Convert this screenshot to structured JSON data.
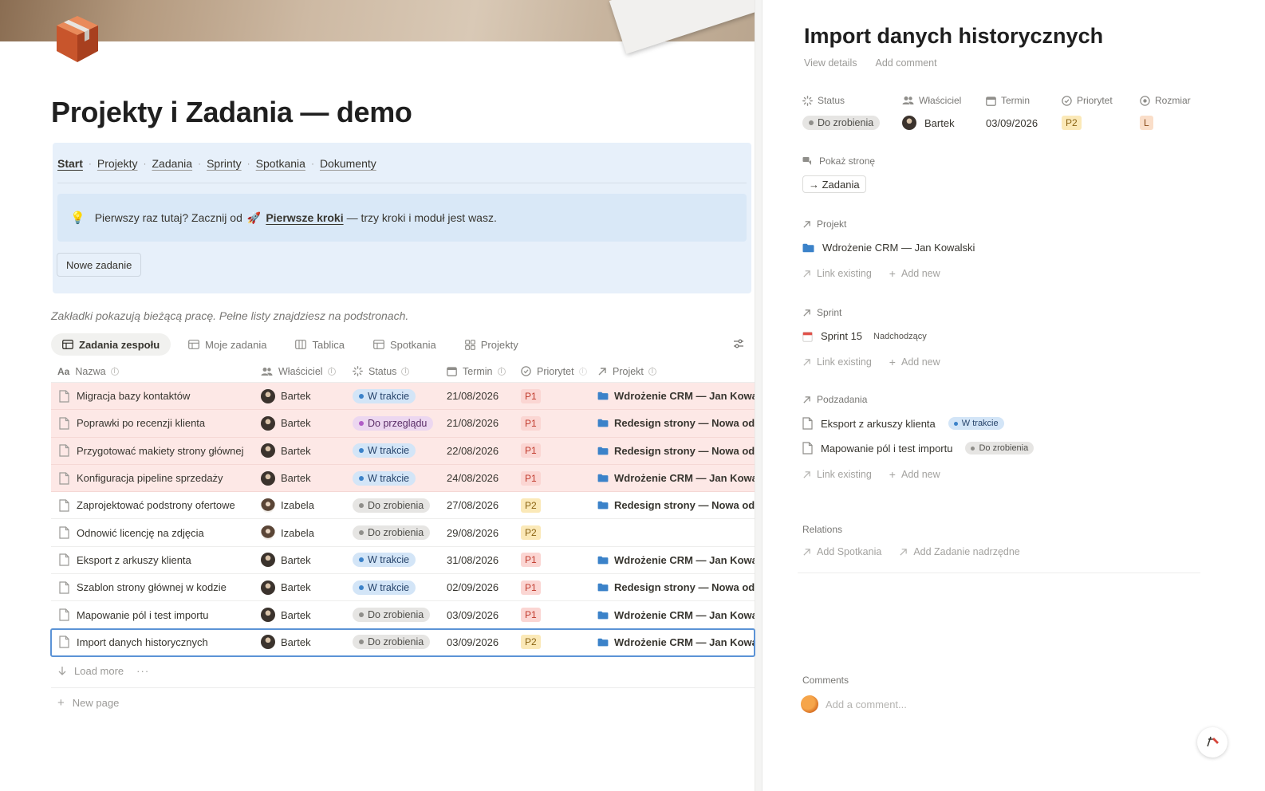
{
  "left": {
    "page_title": "Projekty i Zadania — demo",
    "nav": {
      "items": [
        "Start",
        "Projekty",
        "Zadania",
        "Sprinty",
        "Spotkania",
        "Dokumenty"
      ],
      "separator": "·"
    },
    "tip": {
      "lead": "Pierwszy raz tutaj? Zacznij od",
      "link": "Pierwsze kroki",
      "tail": "— trzy kroki i moduł jest wasz."
    },
    "new_task_button": "Nowe zadanie",
    "note": "Zakładki pokazują bieżącą pracę. Pełne listy znajdziesz na podstronach.",
    "tabs": [
      "Zadania zespołu",
      "Moje zadania",
      "Tablica",
      "Spotkania",
      "Projekty"
    ],
    "columns": [
      "Nazwa",
      "Właściciel",
      "Status",
      "Termin",
      "Priorytet",
      "Projekt"
    ],
    "rows": [
      {
        "name": "Migracja bazy kontaktów",
        "owner": "Bartek",
        "status": "W trakcie",
        "due": "21/08/2026",
        "prio": "P1",
        "project": "Wdrożenie CRM — Jan Kowalski"
      },
      {
        "name": "Poprawki po recenzji klienta",
        "owner": "Bartek",
        "status": "Do przeglądu",
        "due": "21/08/2026",
        "prio": "P1",
        "project": "Redesign strony — Nowa odsłona"
      },
      {
        "name": "Przygotować makiety strony głównej",
        "owner": "Bartek",
        "status": "W trakcie",
        "due": "22/08/2026",
        "prio": "P1",
        "project": "Redesign strony — Nowa odsłona"
      },
      {
        "name": "Konfiguracja pipeline sprzedaży",
        "owner": "Bartek",
        "status": "W trakcie",
        "due": "24/08/2026",
        "prio": "P1",
        "project": "Wdrożenie CRM — Jan Kowalski"
      },
      {
        "name": "Zaprojektować podstrony ofertowe",
        "owner": "Izabela",
        "status": "Do zrobienia",
        "due": "27/08/2026",
        "prio": "P2",
        "project": "Redesign strony — Nowa odsłona"
      },
      {
        "name": "Odnowić licencję na zdjęcia",
        "owner": "Izabela",
        "status": "Do zrobienia",
        "due": "29/08/2026",
        "prio": "P2",
        "project": ""
      },
      {
        "name": "Eksport z arkuszy klienta",
        "owner": "Bartek",
        "status": "W trakcie",
        "due": "31/08/2026",
        "prio": "P1",
        "project": "Wdrożenie CRM — Jan Kowalski"
      },
      {
        "name": "Szablon strony głównej w kodzie",
        "owner": "Bartek",
        "status": "W trakcie",
        "due": "02/09/2026",
        "prio": "P1",
        "project": "Redesign strony — Nowa odsłona"
      },
      {
        "name": "Mapowanie pól i test importu",
        "owner": "Bartek",
        "status": "Do zrobienia",
        "due": "03/09/2026",
        "prio": "P1",
        "project": "Wdrożenie CRM — Jan Kowalski"
      },
      {
        "name": "Import danych historycznych",
        "owner": "Bartek",
        "status": "Do zrobienia",
        "due": "03/09/2026",
        "prio": "P2",
        "project": "Wdrożenie CRM — Jan Kowalski"
      }
    ],
    "load_more": "Load more",
    "load_more_dots": "···",
    "new_page": "New page"
  },
  "right": {
    "title": "Import danych historycznych",
    "links": [
      "View details",
      "Add comment"
    ],
    "props": {
      "status": {
        "label": "Status",
        "value": "Do zrobienia"
      },
      "owner": {
        "label": "Właściciel",
        "value": "Bartek"
      },
      "due": {
        "label": "Termin",
        "value": "03/09/2026"
      },
      "priority": {
        "label": "Priorytet",
        "value": "P2"
      },
      "size": {
        "label": "Rozmiar",
        "value": "L"
      }
    },
    "show_page": {
      "label": "Pokaż stronę",
      "button": "→ Zadania"
    },
    "project": {
      "label": "Projekt",
      "item": "Wdrożenie CRM — Jan Kowalski"
    },
    "sprint": {
      "label": "Sprint",
      "item": "Sprint 15",
      "tag": "Nadchodzący"
    },
    "subtasks": {
      "label": "Podzadania",
      "items": [
        {
          "name": "Eksport z arkuszy klienta",
          "status": "W trakcie"
        },
        {
          "name": "Mapowanie pól i test importu",
          "status": "Do zrobienia"
        }
      ]
    },
    "link_existing": "Link existing",
    "add_new": "Add new",
    "relations": {
      "label": "Relations",
      "items": [
        "Add Spotkania",
        "Add Zadanie nadrzędne"
      ]
    },
    "comments": {
      "label": "Comments",
      "placeholder": "Add a comment..."
    }
  },
  "colors": {
    "accent_blue": "#3b82c9",
    "hot_row": "#fde8e6",
    "callout": "#e7f0fa"
  }
}
